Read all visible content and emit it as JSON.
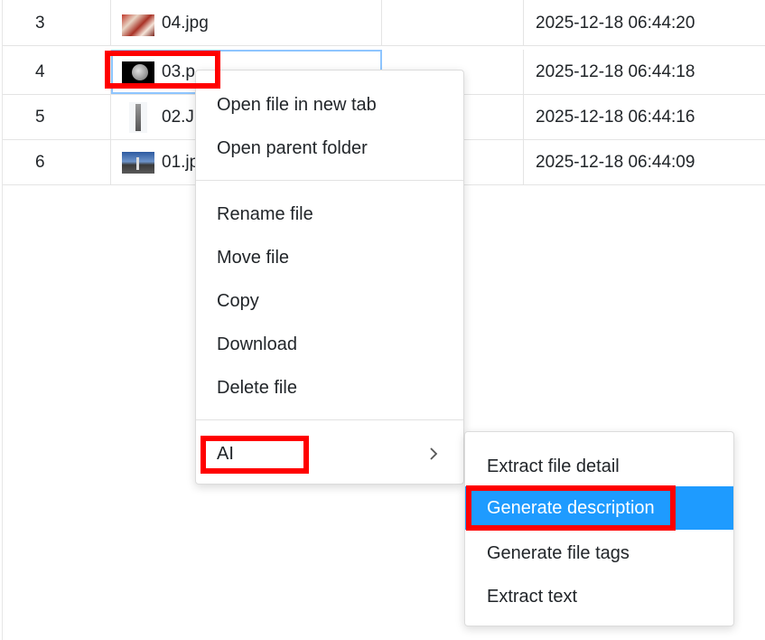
{
  "files": [
    {
      "num": "3",
      "name": "04.jpg",
      "date": "2025-12-18 06:44:20",
      "thumb": "food-photo-thumbnail"
    },
    {
      "num": "4",
      "name": "03.p",
      "date": "2025-12-18 06:44:18",
      "thumb": "moon-photo-thumbnail"
    },
    {
      "num": "5",
      "name": "02.JI",
      "date": "2025-12-18 06:44:16",
      "thumb": "tower-photo-thumbnail"
    },
    {
      "num": "6",
      "name": "01.jp",
      "date": "2025-12-18 06:44:09",
      "thumb": "city-photo-thumbnail"
    }
  ],
  "context_menu": {
    "open_new_tab": "Open file in new tab",
    "open_parent": "Open parent folder",
    "rename": "Rename file",
    "move": "Move file",
    "copy": "Copy",
    "download": "Download",
    "delete": "Delete file",
    "ai": "AI",
    "submenu_icon": "chevron-right-icon"
  },
  "ai_submenu": {
    "extract_detail": "Extract file detail",
    "generate_description": "Generate description",
    "generate_tags": "Generate file tags",
    "extract_text": "Extract text",
    "active_item": "Generate description"
  },
  "colors": {
    "highlight": "#1e9bff",
    "annotation": "#ff0000",
    "focus_outline": "#8ec5ff"
  }
}
